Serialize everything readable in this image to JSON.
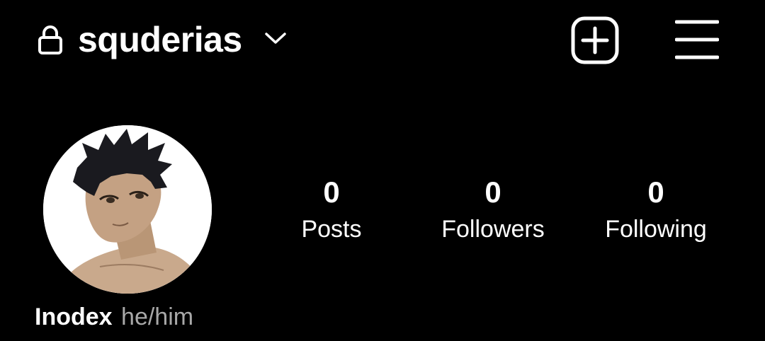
{
  "header": {
    "username": "squderias",
    "icons": {
      "lock": "lock-icon",
      "switcher": "chevron-down-icon",
      "new_post": "plus-square-icon",
      "menu": "hamburger-menu-icon"
    }
  },
  "profile": {
    "display_name": "Inodex",
    "pronouns": "he/him",
    "avatar": "anime-character-avatar"
  },
  "stats": [
    {
      "count": "0",
      "label": "Posts"
    },
    {
      "count": "0",
      "label": "Followers"
    },
    {
      "count": "0",
      "label": "Following"
    }
  ],
  "colors": {
    "background": "#000000",
    "text": "#ffffff",
    "secondary_text": "#a8a8a8"
  }
}
